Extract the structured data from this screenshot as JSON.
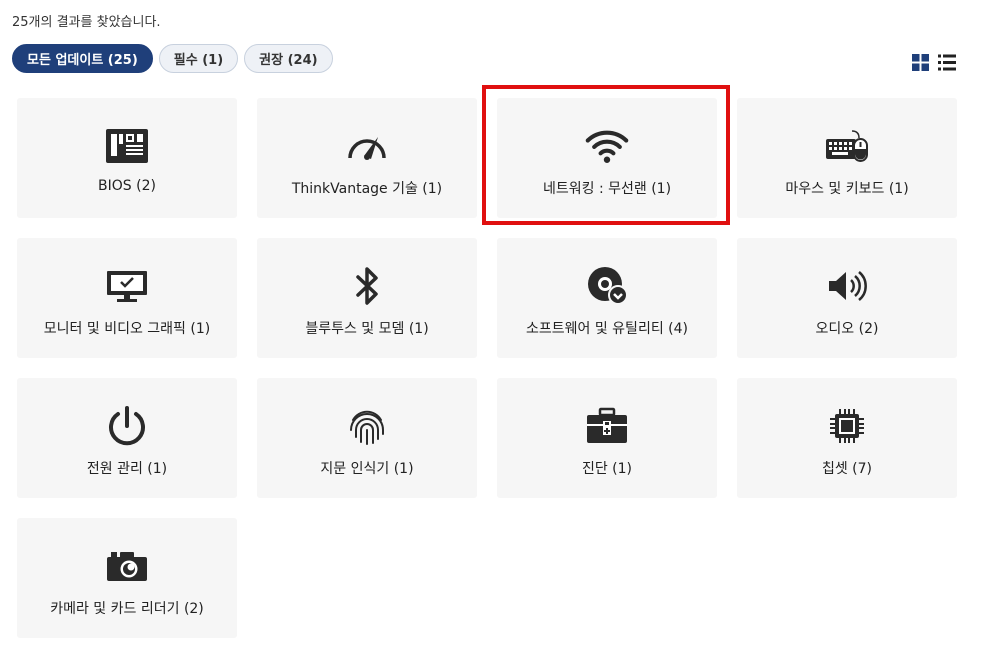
{
  "result_count": "25개의 결과를 찾았습니다.",
  "filters": [
    {
      "label": "모든 업데이트 (25)",
      "active": true
    },
    {
      "label": "필수 (1)",
      "active": false
    },
    {
      "label": "권장 (24)",
      "active": false
    }
  ],
  "view_toggle": {
    "grid_icon": "grid-view-icon",
    "list_icon": "list-view-icon"
  },
  "categories": [
    {
      "label": "BIOS (2)",
      "icon": "motherboard-icon"
    },
    {
      "label": "ThinkVantage 기술 (1)",
      "icon": "gauge-icon"
    },
    {
      "label": "네트워킹 : 무선랜 (1)",
      "icon": "wifi-icon",
      "highlighted": true
    },
    {
      "label": "마우스 및 키보드 (1)",
      "icon": "keyboard-mouse-icon"
    },
    {
      "label": "모니터 및 비디오 그래픽 (1)",
      "icon": "monitor-icon"
    },
    {
      "label": "블루투스 및 모뎀 (1)",
      "icon": "bluetooth-icon"
    },
    {
      "label": "소프트웨어 및 유틸리티 (4)",
      "icon": "software-disc-icon"
    },
    {
      "label": "오디오 (2)",
      "icon": "speaker-icon"
    },
    {
      "label": "전원 관리 (1)",
      "icon": "power-icon"
    },
    {
      "label": "지문 인식기 (1)",
      "icon": "fingerprint-icon"
    },
    {
      "label": "진단 (1)",
      "icon": "toolbox-icon"
    },
    {
      "label": "칩셋 (7)",
      "icon": "chip-icon"
    },
    {
      "label": "카메라 및 카드 리더기 (2)",
      "icon": "camera-icon"
    }
  ],
  "colors": {
    "accent": "#1f3f7a",
    "highlight": "#e01010",
    "icon": "#2a2a2a"
  }
}
